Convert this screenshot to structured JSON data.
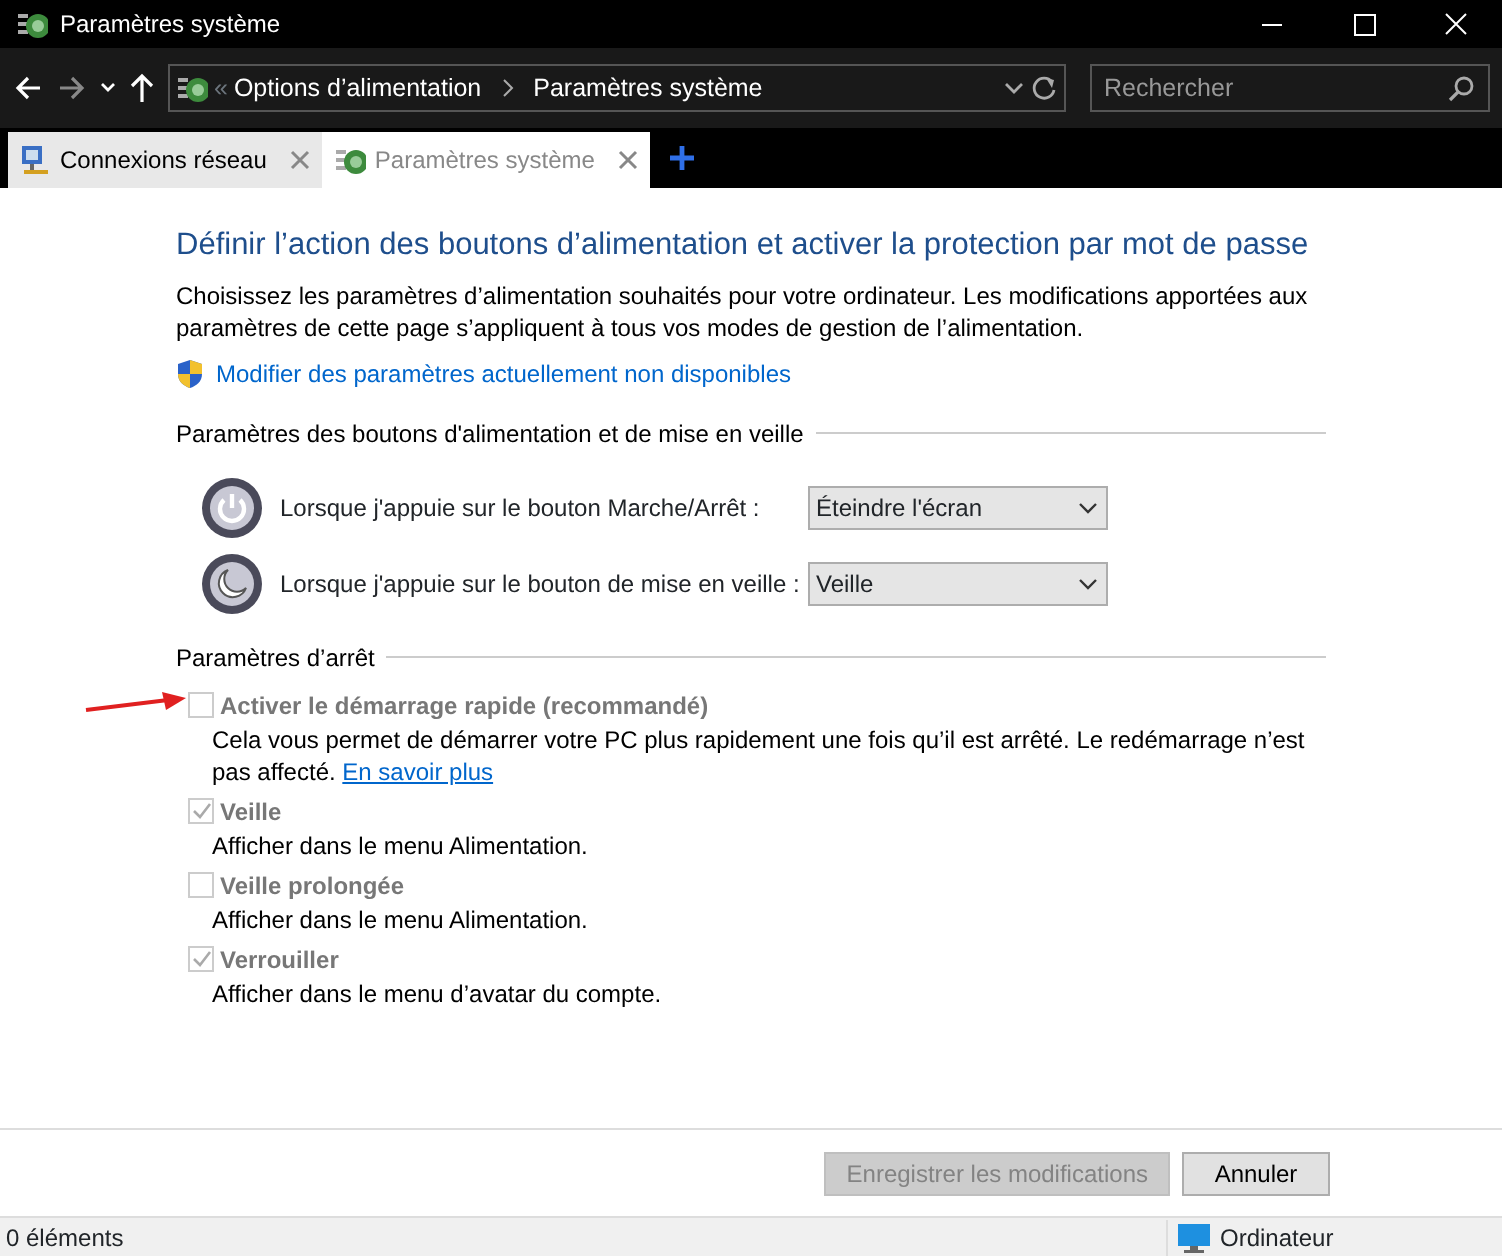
{
  "window": {
    "title": "Paramètres système"
  },
  "address": {
    "overflow": "«",
    "crumbs": [
      "Options d’alimentation",
      "Paramètres système"
    ]
  },
  "search": {
    "placeholder": "Rechercher"
  },
  "tabs": [
    {
      "label": "Connexions réseau",
      "selected": false,
      "kind": "network"
    },
    {
      "label": "Paramètres système",
      "selected": true,
      "kind": "power"
    }
  ],
  "heading": "Définir l’action des boutons d’alimentation et activer la protection par mot de passe",
  "intro": "Choisissez les paramètres d’alimentation souhaités pour votre ordinateur. Les modifications apportées aux paramètres de cette page s’appliquent à tous vos modes de gestion de l’alimentation.",
  "admin_link": "Modifier des paramètres actuellement non disponibles",
  "buttons_section": {
    "title": "Paramètres des boutons d'alimentation et de mise en veille",
    "rows": [
      {
        "kind": "power",
        "label": "Lorsque j'appuie sur le bouton Marche/Arrêt :",
        "value": "Éteindre l'écran"
      },
      {
        "kind": "sleep",
        "label": "Lorsque j'appuie sur le bouton de mise en veille :",
        "value": "Veille"
      }
    ]
  },
  "shutdown_section": {
    "title": "Paramètres d’arrêt",
    "options": [
      {
        "label": "Activer le démarrage rapide (recommandé)",
        "checked": false,
        "disabled": true,
        "description": "Cela vous permet de démarrer votre PC plus rapidement une fois qu’il est arrêté. Le redémarrage n’est pas affecté.",
        "link": "En savoir plus"
      },
      {
        "label": "Veille",
        "checked": true,
        "disabled": true,
        "description": "Afficher dans le menu Alimentation."
      },
      {
        "label": "Veille prolongée",
        "checked": false,
        "disabled": true,
        "description": "Afficher dans le menu Alimentation."
      },
      {
        "label": "Verrouiller",
        "checked": true,
        "disabled": true,
        "description": "Afficher dans le menu d’avatar du compte."
      }
    ]
  },
  "footer": {
    "save": {
      "label": "Enregistrer les modifications",
      "disabled": true
    },
    "cancel": {
      "label": "Annuler",
      "disabled": false
    }
  },
  "status_bar": {
    "items_count": "0 éléments",
    "location": "Ordinateur"
  }
}
